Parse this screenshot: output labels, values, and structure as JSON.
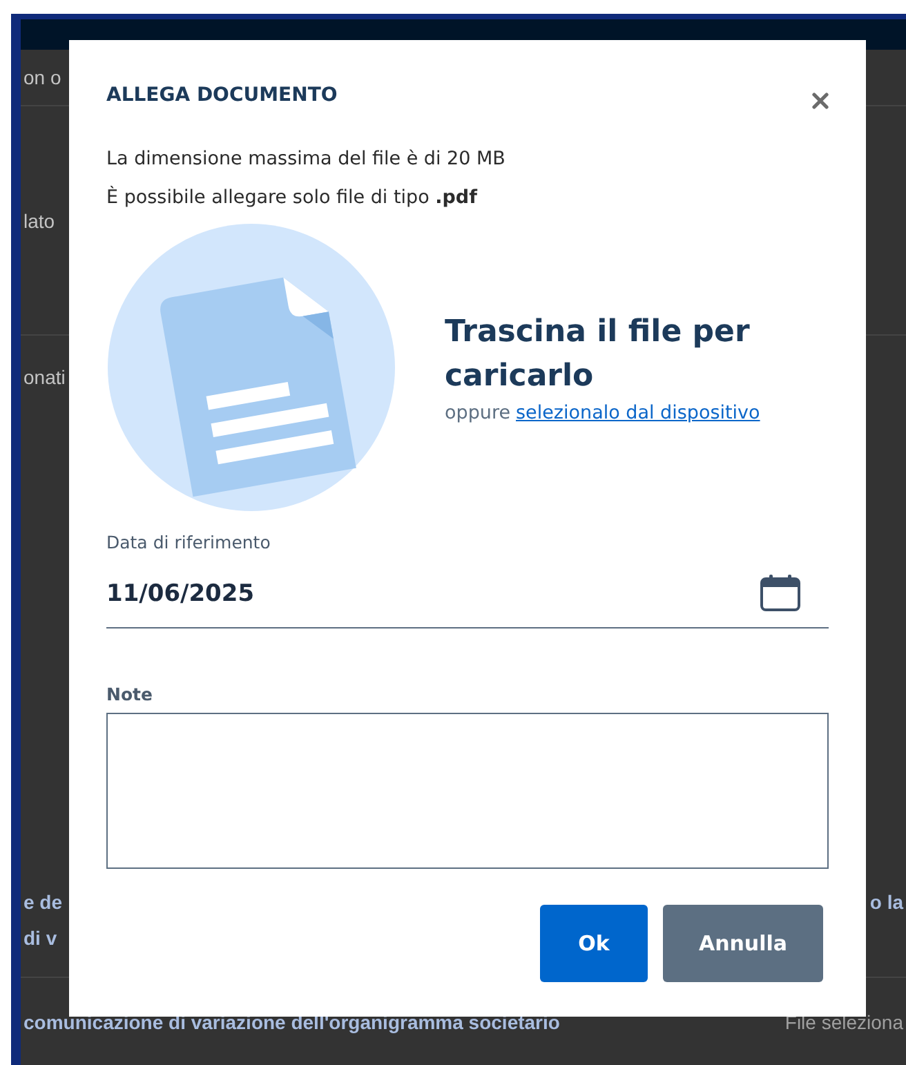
{
  "background": {
    "rows": [
      {
        "left": "on o",
        "right": ""
      },
      {
        "left": "lato",
        "right": ""
      },
      {
        "left": "onati",
        "right": ""
      },
      {
        "left": "e de",
        "right": "o la"
      },
      {
        "left": "di v",
        "right": ""
      },
      {
        "left": "comunicazione di variazione dell'organigramma societario",
        "right": "File seleziona"
      }
    ]
  },
  "dialog": {
    "title": "ALLEGA DOCUMENTO",
    "info": [
      "La dimensione massima del file è di 20 MB",
      "È possibile allegare solo file di tipo **.pdf**"
    ],
    "dropzone": {
      "heading": "Trascina il file per caricarlo",
      "prefix": "oppure",
      "link": "selezionalo dal dispositivo"
    },
    "date_field": {
      "label": "Data di riferimento",
      "value": "11/06/2025"
    },
    "note_field": {
      "label": "Note"
    },
    "buttons": [
      {
        "label": "Ok",
        "kind": "primary"
      },
      {
        "label": "Annulla",
        "kind": "secondary"
      }
    ]
  }
}
